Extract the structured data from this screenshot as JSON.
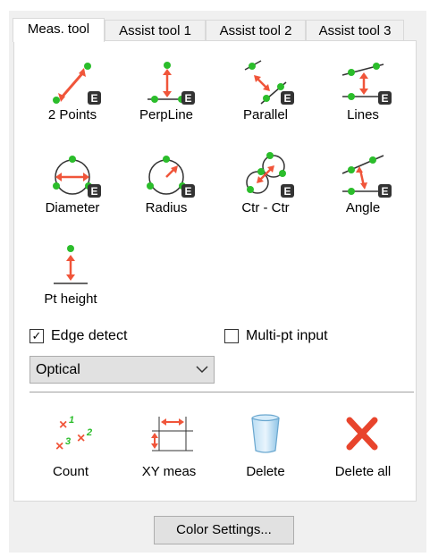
{
  "tabs": [
    {
      "label": "Meas. tool"
    },
    {
      "label": "Assist tool 1"
    },
    {
      "label": "Assist tool 2"
    },
    {
      "label": "Assist tool 3"
    }
  ],
  "tools": [
    {
      "label": "2 Points"
    },
    {
      "label": "PerpLine"
    },
    {
      "label": "Parallel"
    },
    {
      "label": "Lines"
    },
    {
      "label": "Diameter"
    },
    {
      "label": "Radius"
    },
    {
      "label": "Ctr - Ctr"
    },
    {
      "label": "Angle"
    },
    {
      "label": "Pt height"
    }
  ],
  "badge_letter": "E",
  "options": {
    "edge_detect": {
      "label": "Edge detect",
      "checked": true
    },
    "multi_pt": {
      "label": "Multi-pt input",
      "checked": false
    }
  },
  "mode_select": {
    "value": "Optical"
  },
  "bottom": [
    {
      "label": "Count"
    },
    {
      "label": "XY meas"
    },
    {
      "label": "Delete"
    },
    {
      "label": "Delete all"
    }
  ],
  "count_icon_digits": [
    "1",
    "2",
    "3"
  ],
  "color_settings_label": "Color Settings...",
  "colors": {
    "green": "#2bbd2b",
    "red": "#f0553a",
    "badge": "#333333",
    "panel_bg": "#f0f0f0"
  }
}
